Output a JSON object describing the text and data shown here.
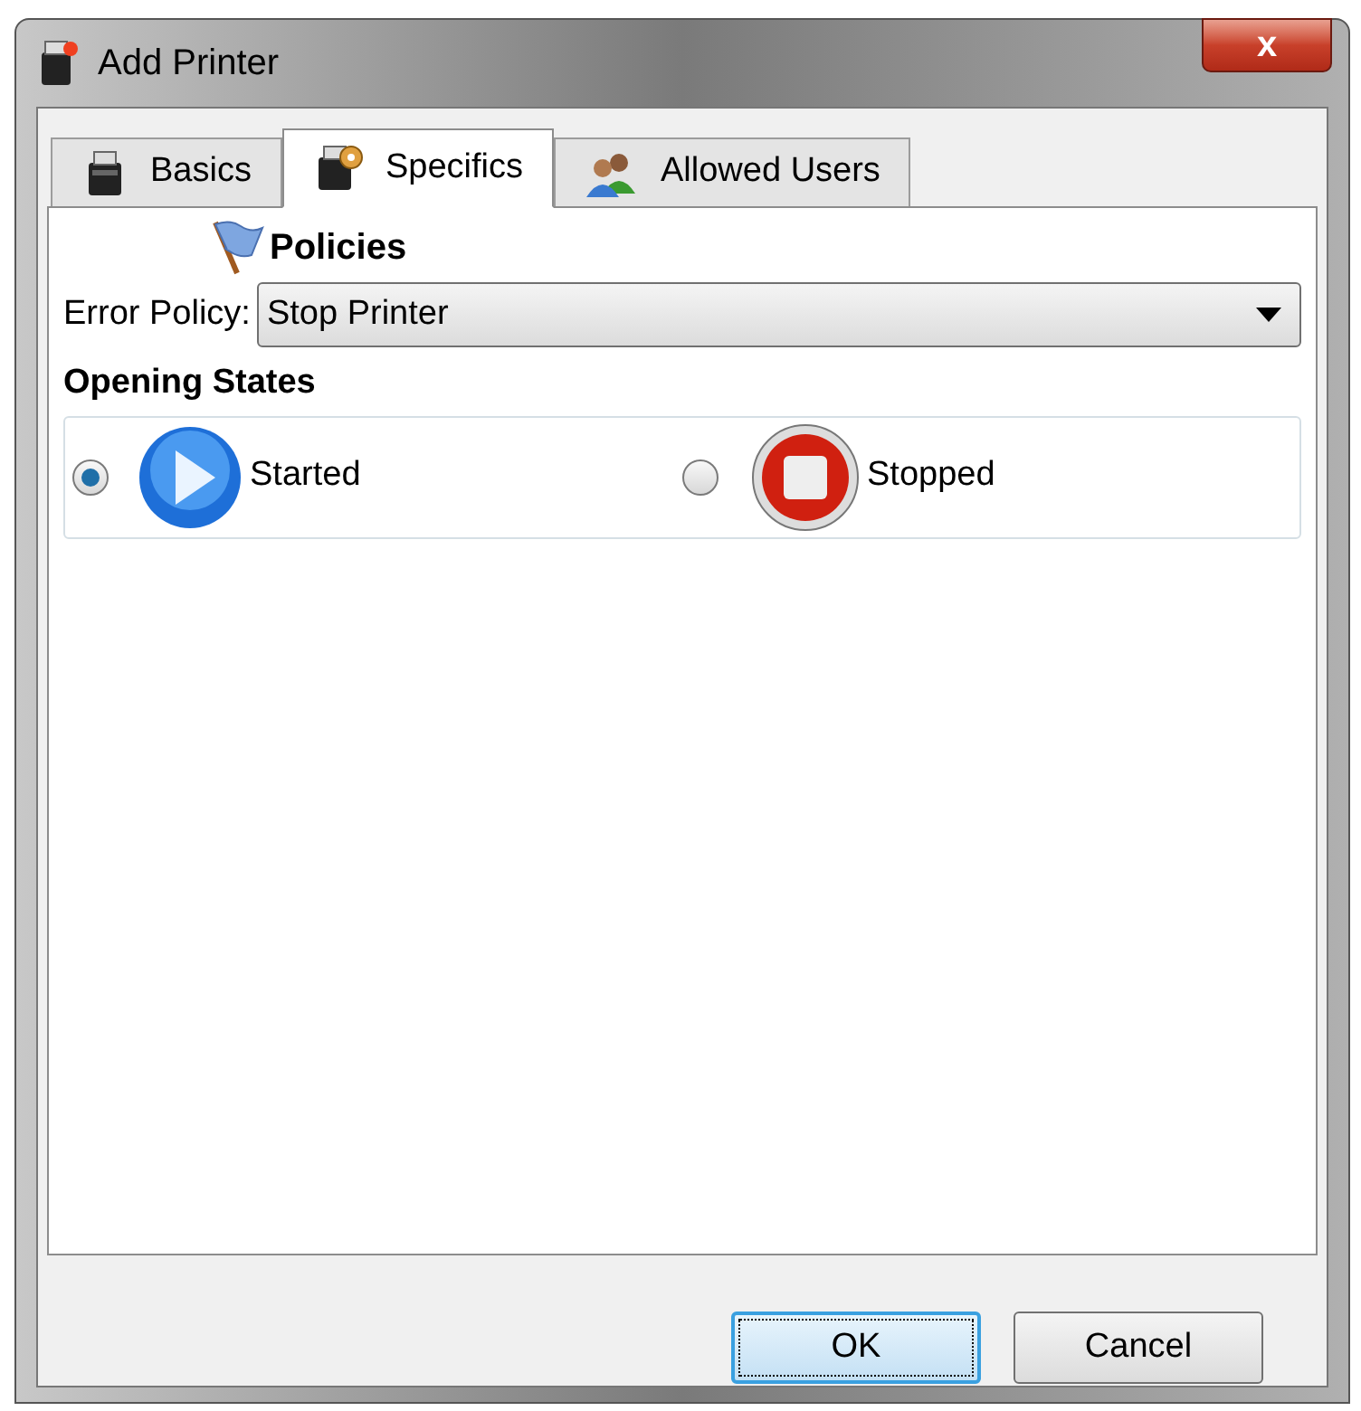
{
  "window": {
    "title": "Add Printer",
    "close": "x"
  },
  "tabs": [
    {
      "label": "Basics",
      "selected": false,
      "kind": "printer"
    },
    {
      "label": "Specifics",
      "selected": true,
      "kind": "printer-gear"
    },
    {
      "label": "Allowed Users",
      "selected": false,
      "kind": "users"
    }
  ],
  "policies": {
    "heading": "Policies",
    "error_policy": {
      "label": "Error Policy:",
      "value": "Stop Printer"
    }
  },
  "opening_states": {
    "heading": "Opening States",
    "options": [
      {
        "label": "Started",
        "kind": "play",
        "selected": true
      },
      {
        "label": "Stopped",
        "kind": "stop",
        "selected": false
      }
    ]
  },
  "buttons": [
    {
      "label": "OK",
      "kind": "default"
    },
    {
      "label": "Cancel",
      "kind": "normal"
    }
  ]
}
